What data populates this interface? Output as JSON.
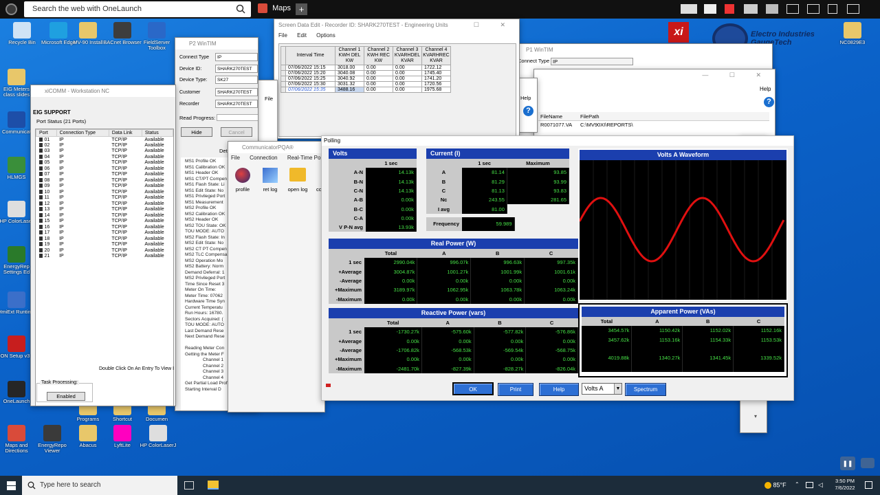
{
  "topbar": {
    "search_text": "Search the web with OneLaunch",
    "maps_label": "Maps",
    "plus": "+"
  },
  "desktop_icons": [
    {
      "label": "Recycle Bin",
      "color": "#cfe3f5"
    },
    {
      "label": "Microsoft Edge",
      "color": "#1fa0e0"
    },
    {
      "label": "MV-90 Install",
      "color": "#e8c76a"
    },
    {
      "label": "BACnet Browser",
      "color": "#3d3d3d"
    },
    {
      "label": "FieldServer Toolbox",
      "color": "#2a68c8"
    },
    {
      "label": "EIG Meters class slides",
      "color": "#e8c76a"
    },
    {
      "label": "Communicat",
      "color": "#1d4ea8"
    },
    {
      "label": "HLMGS",
      "color": "#3a8f3a"
    },
    {
      "label": "HP ColorLaser",
      "color": "#dedede"
    },
    {
      "label": "EnergyRep Settings Ed",
      "color": "#2a7a2a"
    },
    {
      "label": "HmiExt Runtime",
      "color": "#3b6fc9"
    },
    {
      "label": "ION Setup v3.0",
      "color": "#c71e1e"
    },
    {
      "label": "OneLaunch",
      "color": "#262626"
    },
    {
      "label": "Maps and Directions",
      "color": "#d94b3a"
    },
    {
      "label": "EnergyRepo Viewer",
      "color": "#3a3a3a"
    },
    {
      "label": "Abacus",
      "color": "#e8c76a"
    },
    {
      "label": "LyftLite",
      "color": "#ff00bf"
    },
    {
      "label": "HP ColorLaserJ",
      "color": "#dedede"
    },
    {
      "label": "Programs",
      "color": "#e8c76a"
    },
    {
      "label": "Shortcut",
      "color": "#e8c76a"
    },
    {
      "label": "Documen",
      "color": "#e8c76a"
    },
    {
      "label": "NC0829E3",
      "color": "#e8c76a"
    }
  ],
  "eig_logo": {
    "line1": "Electro Industries",
    "line2": "GaugeTech",
    "badge": "xi"
  },
  "xicomm": {
    "title": "xiCOMM - Workstation NC",
    "support": "EIG SUPPORT",
    "port_status": "Port Status (21 Ports)",
    "cols": [
      "Port",
      "Connection Type",
      "Data Link",
      "Status"
    ],
    "rows": [
      [
        "01",
        "IP",
        "TCP/IP",
        "Available"
      ],
      [
        "02",
        "IP",
        "TCP/IP",
        "Available"
      ],
      [
        "03",
        "IP",
        "TCP/IP",
        "Available"
      ],
      [
        "04",
        "IP",
        "TCP/IP",
        "Available"
      ],
      [
        "05",
        "IP",
        "TCP/IP",
        "Available"
      ],
      [
        "06",
        "IP",
        "TCP/IP",
        "Available"
      ],
      [
        "07",
        "IP",
        "TCP/IP",
        "Available"
      ],
      [
        "08",
        "IP",
        "TCP/IP",
        "Available"
      ],
      [
        "09",
        "IP",
        "TCP/IP",
        "Available"
      ],
      [
        "10",
        "IP",
        "TCP/IP",
        "Available"
      ],
      [
        "11",
        "IP",
        "TCP/IP",
        "Available"
      ],
      [
        "12",
        "IP",
        "TCP/IP",
        "Available"
      ],
      [
        "13",
        "IP",
        "TCP/IP",
        "Available"
      ],
      [
        "14",
        "IP",
        "TCP/IP",
        "Available"
      ],
      [
        "15",
        "IP",
        "TCP/IP",
        "Available"
      ],
      [
        "16",
        "IP",
        "TCP/IP",
        "Available"
      ],
      [
        "17",
        "IP",
        "TCP/IP",
        "Available"
      ],
      [
        "18",
        "IP",
        "TCP/IP",
        "Available"
      ],
      [
        "19",
        "IP",
        "TCP/IP",
        "Available"
      ],
      [
        "20",
        "IP",
        "TCP/IP",
        "Available"
      ],
      [
        "21",
        "IP",
        "TCP/IP",
        "Available"
      ]
    ],
    "hint": "Double Click On An Entry To View I",
    "task_processing": "Task Processing:",
    "enabled": "Enabled"
  },
  "p2": {
    "title": "P2 WinTIM",
    "connect_type_label": "Connect Type",
    "connect_type": "IP",
    "device_id_label": "Device ID:",
    "device_id": "SHARK270TEST",
    "device_type_label": "Device Type:",
    "device_type": "SK27",
    "customer_label": "Customer",
    "customer": "SHARK270TEST",
    "recorder_label": "Recorder",
    "recorder": "SHARK270TEST",
    "read_progress": "Read Progress:",
    "hide": "Hide",
    "cancel": "Cancel",
    "detail": "Det",
    "log": [
      "MS1 Profile OK",
      "MS1 Calibration OK",
      "MS1 Header OK",
      "MS1 CT/PT Compen",
      "MS1 Flash State: Li",
      "MS1 Edit State: No",
      "MS1 Privileged Port",
      "MS1 Measurement",
      "MS2 Profile OK",
      "MS2 Calibration OK",
      "MS2 Header OK",
      "MS2 TOU State: OK",
      "TOU MODE: AUTO",
      "MS2 Flash State: In",
      "MS2 Edit State: No",
      "MS2 CT PT Compen",
      "MS2 TLC Compensa",
      "MS2 Operation Mo",
      "MS2 Battery: Norm",
      "Demand Deferral: 1",
      "MS2 Privileged Port",
      "Time Since Reset 3",
      "Meter On Time:",
      "Meter Time: 07062",
      "Hardware Time Syn",
      "Current Temperatu",
      "Run Hours: 16780.",
      "Sectors Acquired: (",
      "TOU MODE: AUTO",
      "Last Demand Rese",
      "Next Demand Rese",
      "",
      "Reading Meter Con",
      "Getting the Meter F",
      "Channel 1",
      "Channel 2",
      "Channel 3",
      "Channel 4",
      "Get Partial Load Profi",
      "Starting Interval D"
    ]
  },
  "sde": {
    "title": "Screen Data Edit - Recorder ID: SHARK270TEST - Engineering Units",
    "menu": [
      "File",
      "Edit",
      "Options"
    ],
    "cols": [
      "Interval Time",
      "Channel 1 KWH DEL KW",
      "Channel 2 KWH REC KW",
      "Channel 3 KVARHDEL KVAR",
      "Channel 4 KVARHREC KVAR"
    ],
    "rows": [
      [
        "07/06/2022 15:15",
        "3018.00",
        "0.00",
        "0.00",
        "1722.12"
      ],
      [
        "07/06/2022 15:20",
        "3040.08",
        "0.00",
        "0.00",
        "1745.40"
      ],
      [
        "07/06/2022 15:25",
        "3040.92",
        "0.00",
        "0.00",
        "1741.20"
      ],
      [
        "07/06/2022 15:30",
        "3031.32",
        "0.00",
        "0.00",
        "1720.56"
      ],
      [
        "07/06/2022 15:35",
        "3488.16",
        "0.00",
        "0.00",
        "1975.68"
      ]
    ]
  },
  "p1": {
    "title": "P1 WinTIM",
    "connect_type_label": "Connect Type",
    "connect_type": "IP",
    "help": "Help",
    "file_name_col": "FileName",
    "file_path_col": "FilePath",
    "file_name": "R0071077.VA",
    "file_path": "C:\\MV90XI\\REPORTS\\"
  },
  "cpqa": {
    "title": "CommunicatorPQA®",
    "menu": [
      "File",
      "Connection",
      "Real-Time Poll"
    ],
    "icons": [
      "profile",
      "ret log",
      "open log",
      "cc"
    ]
  },
  "small_dialog": {
    "help": "Help",
    "file": "File"
  },
  "polling": {
    "title": "Polling",
    "volts": {
      "header": "Volts",
      "col": "1 sec",
      "rows": [
        [
          "A-N",
          "14.13k"
        ],
        [
          "B-N",
          "14.13k"
        ],
        [
          "C-N",
          "14.13k"
        ],
        [
          "A-B",
          "0.00k"
        ],
        [
          "B-C",
          "0.00k"
        ],
        [
          "C-A",
          "0.00k"
        ],
        [
          "V P-N avg",
          "13.93k"
        ]
      ]
    },
    "current": {
      "header": "Current (I)",
      "cols": [
        "1 sec",
        "Maximum"
      ],
      "rows": [
        [
          "A",
          "81.14",
          "93.85"
        ],
        [
          "B",
          "81.29",
          "93.99"
        ],
        [
          "C",
          "81.13",
          "93.83"
        ],
        [
          "Nc",
          "243.55",
          "281.65"
        ],
        [
          "I avg",
          "81.00",
          ""
        ]
      ]
    },
    "frequency": {
      "label": "Frequency",
      "value": "59.989"
    },
    "waveform": {
      "header": "Volts A Waveform",
      "color": "#e01010"
    },
    "real_power": {
      "header": "Real Power (W)",
      "cols": [
        "Total",
        "A",
        "B",
        "C"
      ],
      "rows": [
        [
          "1 sec",
          "2990.04k",
          "996.07k",
          "996.63k",
          "997.35k"
        ],
        [
          "+Average",
          "3004.87k",
          "1001.27k",
          "1001.99k",
          "1001.61k"
        ],
        [
          "-Average",
          "0.00k",
          "0.00k",
          "0.00k",
          "0.00k"
        ],
        [
          "+Maximum",
          "3189.97k",
          "1062.95k",
          "1063.78k",
          "1063.24k"
        ],
        [
          "-Maximum",
          "0.00k",
          "0.00k",
          "0.00k",
          "0.00k"
        ]
      ]
    },
    "reactive_power": {
      "header": "Reactive Power (vars)",
      "cols": [
        "Total",
        "A",
        "B",
        "C"
      ],
      "rows": [
        [
          "1 sec",
          "-1730.27k",
          "-575.60k",
          "-577.82k",
          "-576.86k"
        ],
        [
          "+Average",
          "0.00k",
          "0.00k",
          "0.00k",
          "0.00k"
        ],
        [
          "-Average",
          "-1706.82k",
          "-568.53k",
          "-569.54k",
          "-568.75k"
        ],
        [
          "+Maximum",
          "0.00k",
          "0.00k",
          "0.00k",
          "0.00k"
        ],
        [
          "-Maximum",
          "-2481.70k",
          "-827.39k",
          "-828.27k",
          "-826.04k"
        ]
      ]
    },
    "apparent_power": {
      "header": "Apparent Power (VAs)",
      "cols": [
        "Total",
        "A",
        "B",
        "C"
      ],
      "rows": [
        [
          "3454.57k",
          "1150.42k",
          "1152.02k",
          "1152.16k"
        ],
        [
          "3457.62k",
          "1153.16k",
          "1154.33k",
          "1153.53k"
        ],
        [
          "",
          "",
          "",
          ""
        ],
        [
          "4019.88k",
          "1340.27k",
          "1341.45k",
          "1339.52k"
        ],
        [
          "",
          "",
          "",
          ""
        ]
      ]
    },
    "buttons": {
      "ok": "OK",
      "print": "Print",
      "help": "Help",
      "select": "Volts A",
      "spectrum": "Spectrum"
    }
  },
  "taskbar": {
    "search_placeholder": "Type here to search",
    "temp": "85°F",
    "time": "3:50 PM",
    "date": "7/6/2022"
  }
}
